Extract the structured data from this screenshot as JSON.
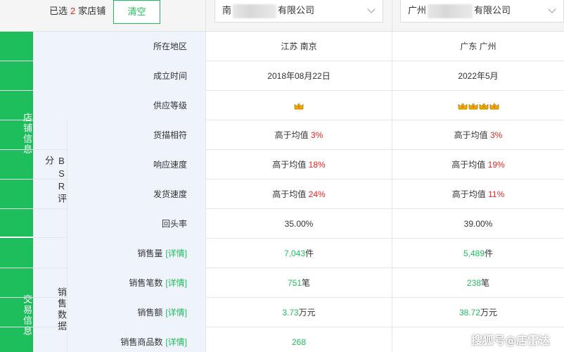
{
  "header": {
    "selected_prefix": "已选",
    "selected_count": "2",
    "selected_suffix": "家店铺",
    "clear_label": "清空",
    "stores": [
      {
        "prefix": "南",
        "suffix": "有限公司"
      },
      {
        "prefix": "广州",
        "suffix": "有限公司"
      }
    ]
  },
  "sections": {
    "store_info": "店铺信息",
    "bsr_score": "BSR评分",
    "trade_info": "交易信息",
    "sales_data": "销售数据"
  },
  "rows": {
    "region": {
      "label": "所在地区",
      "values": [
        "江苏 南京",
        "广东 广州"
      ]
    },
    "founded": {
      "label": "成立时间",
      "values": [
        "2018年08月22日",
        "2022年5月"
      ]
    },
    "supply_level": {
      "label": "供应等级",
      "crowns": [
        1,
        4
      ]
    },
    "match": {
      "label": "货描相符",
      "prefix": "高于均值",
      "values": [
        "3%",
        "3%"
      ]
    },
    "response": {
      "label": "响应速度",
      "prefix": "高于均值",
      "values": [
        "18%",
        "19%"
      ]
    },
    "shipping": {
      "label": "发货速度",
      "prefix": "高于均值",
      "values": [
        "24%",
        "11%"
      ]
    },
    "repeat_rate": {
      "label": "回头率",
      "values": [
        "35.00%",
        "39.00%"
      ]
    },
    "sales_qty": {
      "label": "销售量",
      "detail": "[详情]",
      "values": [
        "7,043",
        "5,489"
      ],
      "unit": "件"
    },
    "sales_orders": {
      "label": "销售笔数",
      "detail": "[详情]",
      "values": [
        "751",
        "238"
      ],
      "unit": "笔"
    },
    "sales_amount": {
      "label": "销售额",
      "detail": "[详情]",
      "values": [
        "3.73",
        "38.72"
      ],
      "unit": "万元"
    },
    "sales_products": {
      "label": "销售商品数",
      "detail": "[详情]",
      "values": [
        "268",
        ""
      ]
    }
  },
  "watermark": "搜狐号@店雷达",
  "colors": {
    "accent": "#1fbe5c",
    "highlight": "#e0281e",
    "label_bg": "#eef3fc"
  }
}
